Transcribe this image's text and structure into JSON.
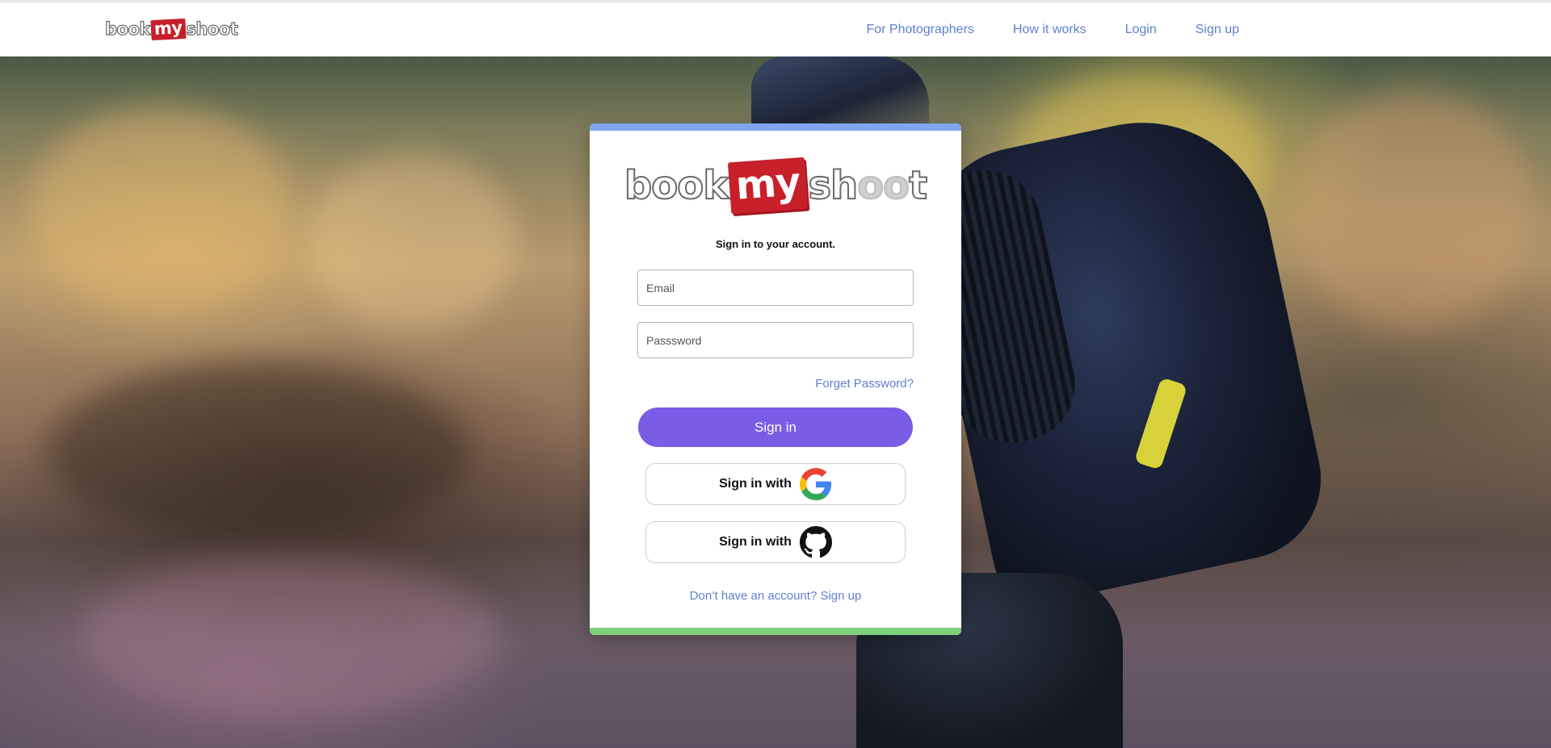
{
  "header": {
    "brand": {
      "part1": "book",
      "part2": "my",
      "part3_a": "sh",
      "part3_b": "oo",
      "part3_c": "t"
    },
    "nav": [
      "For Photographers",
      "How it works",
      "Login",
      "Sign up"
    ]
  },
  "card": {
    "brand": {
      "part1": "book",
      "part2": "my",
      "part3_a": "sh",
      "part3_b": "oo",
      "part3_c": "t"
    },
    "subtitle": "Sign in to your account.",
    "email_placeholder": "Email",
    "password_placeholder": "Passsword",
    "forget_label": "Forget Password?",
    "signin_label": "Sign in",
    "google_label": "Sign in with",
    "github_label": "Sign in with",
    "signup_text": "Don’t have an account? Sign up",
    "icons": {
      "google": "google-logo-icon",
      "github": "github-logo-icon"
    }
  },
  "colors": {
    "primary_button": "#7a5ce6",
    "link": "#5f7fd0",
    "card_top_bar": "#7fa6ee",
    "card_bottom_bar": "#7fd07a",
    "brand_red": "#c8202b"
  }
}
